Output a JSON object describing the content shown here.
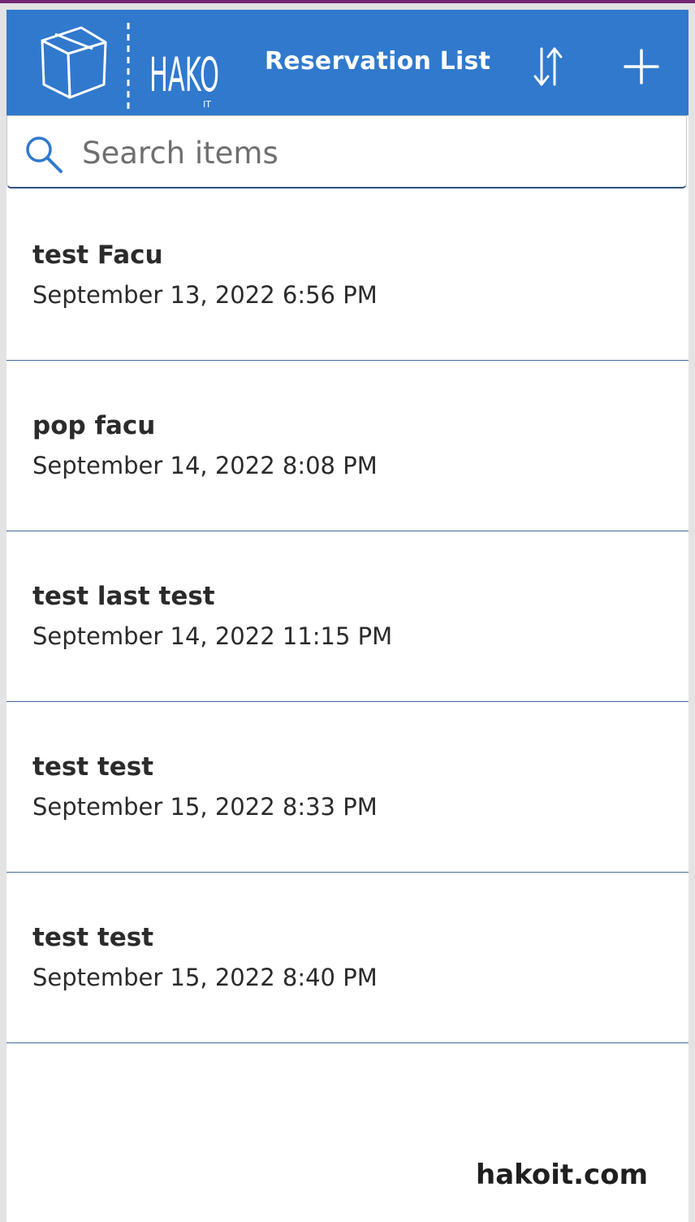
{
  "header": {
    "logo_text": "HAKO",
    "logo_subtext": "IT",
    "title": "Reservation List",
    "sort_icon": "sort-icon",
    "add_icon": "plus-icon",
    "background_color": "#3079cd"
  },
  "search": {
    "placeholder": "Search items",
    "value": "",
    "icon": "search-icon"
  },
  "reservations": [
    {
      "title": "test Facu",
      "date": "September 13, 2022 6:56 PM"
    },
    {
      "title": "pop facu",
      "date": "September 14, 2022 8:08 PM"
    },
    {
      "title": "test last test",
      "date": "September 14, 2022 11:15 PM"
    },
    {
      "title": "test test",
      "date": "September 15, 2022 8:33 PM"
    },
    {
      "title": "test test",
      "date": "September 15, 2022 8:40 PM"
    }
  ],
  "footer": {
    "brand": "hakoit.com"
  },
  "colors": {
    "accent": "#3079cd",
    "top_strip": "#742774",
    "divider": "#3f6aa0",
    "search_icon": "#3079cd"
  }
}
